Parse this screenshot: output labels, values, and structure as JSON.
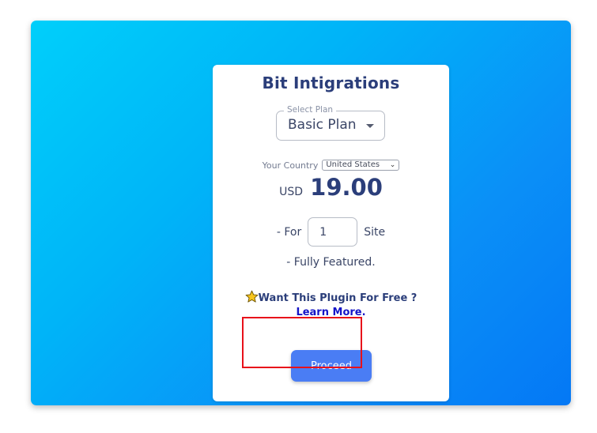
{
  "card": {
    "title": "Bit Intigrations",
    "plan": {
      "legend": "Select Plan",
      "selected": "Basic Plan"
    },
    "country": {
      "label": "Your Country",
      "selected": "United States"
    },
    "price": {
      "currency": "USD",
      "amount": "19.00"
    },
    "sites": {
      "prefix": "- For",
      "value": "1",
      "suffix": "Site"
    },
    "feature_line": "- Fully Featured.",
    "promo": {
      "icon": "star-icon",
      "text": "Want This Plugin For Free ?",
      "link": "Learn More."
    },
    "proceed_label": "Proceed"
  },
  "colors": {
    "title": "#2b3e7a",
    "link": "#1414c8",
    "button": "#4a7df4",
    "highlight": "#e8101a",
    "gradient_start": "#00cffa",
    "gradient_end": "#0478f5"
  }
}
